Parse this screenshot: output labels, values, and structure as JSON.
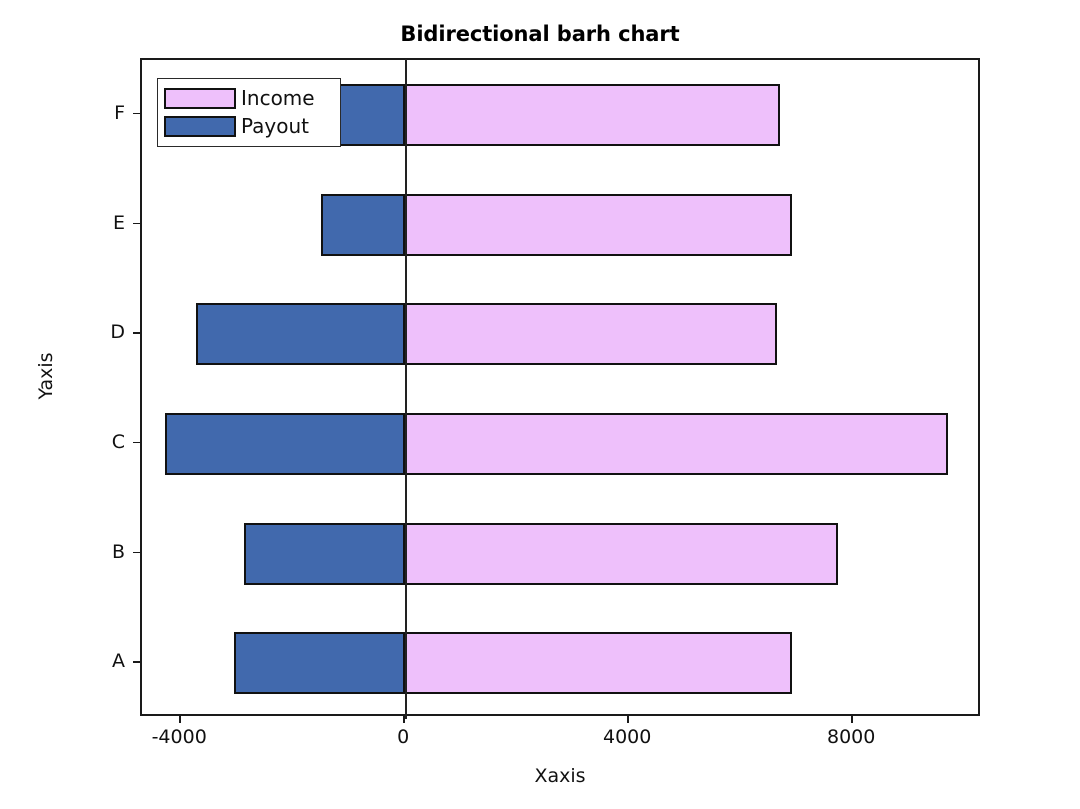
{
  "chart_data": {
    "type": "bar",
    "orientation": "horizontal",
    "title": "Bidirectional barh chart",
    "xlabel": "Xaxis",
    "ylabel": "Yaxis",
    "categories": [
      "A",
      "B",
      "C",
      "D",
      "E",
      "F"
    ],
    "series": [
      {
        "name": "Income",
        "color": "#eec0fb",
        "values": [
          6900,
          7730,
          9700,
          6640,
          6900,
          6690
        ]
      },
      {
        "name": "Payout",
        "color": "#4169ad",
        "values": [
          -3050,
          -2880,
          -4290,
          -3730,
          -1500,
          -1200
        ]
      }
    ],
    "xlim": [
      -4700,
      10300
    ],
    "xticks": [
      -4000,
      0,
      4000,
      8000
    ],
    "xticklabels": [
      "-4000",
      "0",
      "4000",
      "8000"
    ],
    "grid": false,
    "legend_position": "upper left",
    "zero_line": 0
  },
  "legend": {
    "entries": [
      {
        "label": "Income"
      },
      {
        "label": "Payout"
      }
    ]
  }
}
